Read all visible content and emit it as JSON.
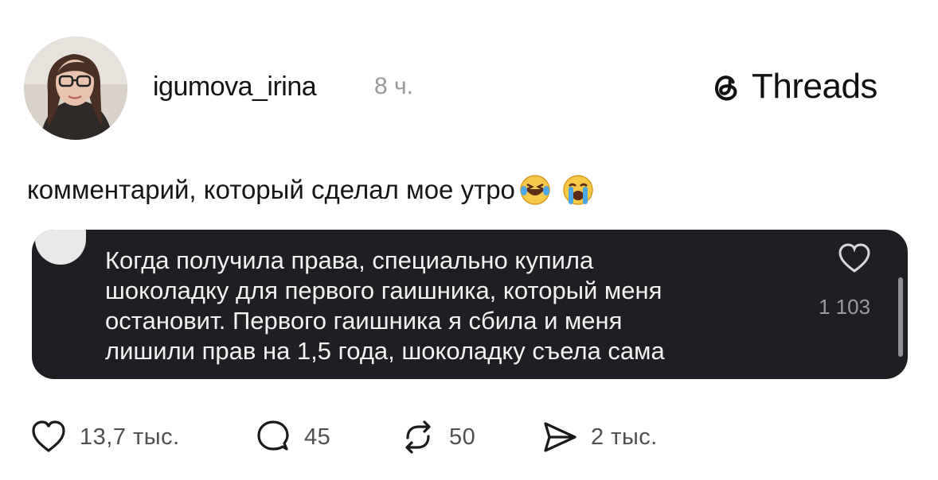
{
  "post": {
    "username": "igumova_irina",
    "time": "8 ч.",
    "text": "комментарий, который сделал мое утро"
  },
  "brand": {
    "name": "Threads",
    "icon": "threads-logo-icon"
  },
  "comment": {
    "lines": [
      "Когда получила права, специально купила",
      "шоколадку для первого гаишника, который меня",
      "остановит. Первого гаишника я сбила и меня",
      "лишили прав на 1,5 года, шоколадку съела сама"
    ],
    "likes": "1 103"
  },
  "actions": {
    "likes": "13,7 тыс.",
    "replies": "45",
    "reposts": "50",
    "shares": "2 тыс."
  },
  "colors": {
    "comment_background": "#1f1f23",
    "muted_text": "#9a9a9a",
    "action_text": "#4f4f4f"
  }
}
